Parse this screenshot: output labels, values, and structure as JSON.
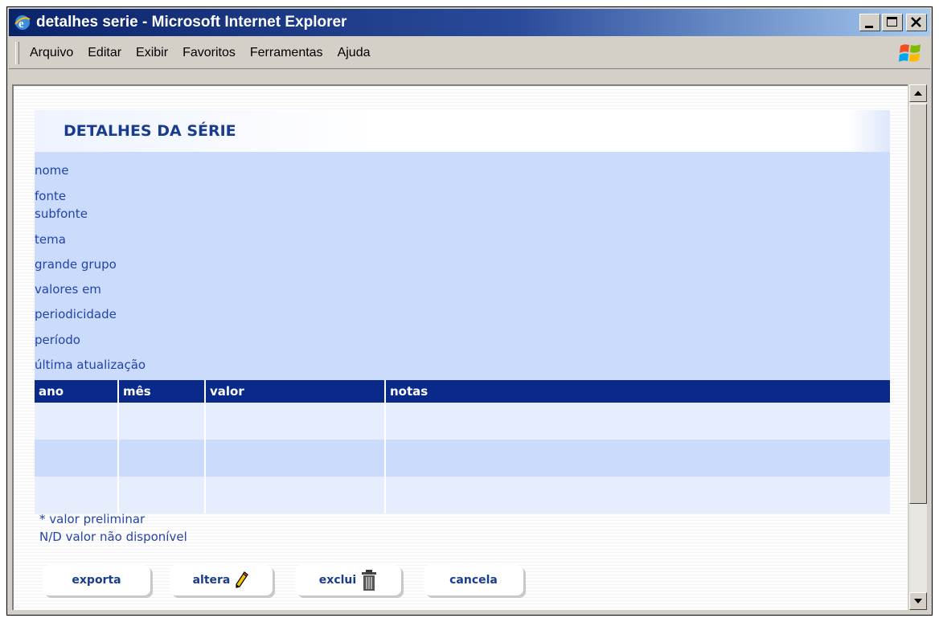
{
  "window": {
    "title": "detalhes serie - Microsoft Internet Explorer"
  },
  "menu": {
    "items": [
      {
        "label": "Arquivo"
      },
      {
        "label": "Editar"
      },
      {
        "label": "Exibir"
      },
      {
        "label": "Favoritos"
      },
      {
        "label": "Ferramentas"
      },
      {
        "label": "Ajuda"
      }
    ]
  },
  "page": {
    "title": "DETALHES DA SÉRIE",
    "fields": [
      {
        "label": "nome"
      },
      {
        "label": "fonte"
      },
      {
        "label": "subfonte"
      },
      {
        "label": "tema"
      },
      {
        "label": "grande grupo"
      },
      {
        "label": "valores em"
      },
      {
        "label": "periodicidade"
      },
      {
        "label": "período"
      },
      {
        "label": "última atualização"
      }
    ],
    "table": {
      "columns": [
        "ano",
        "mês",
        "valor",
        "notas"
      ]
    },
    "notes": {
      "preliminary": "* valor preliminar",
      "unavailable": "N/D valor não disponível"
    },
    "buttons": {
      "exporta": "exporta",
      "altera": "altera",
      "exclui": "exclui",
      "cancela": "cancela"
    }
  },
  "colors": {
    "title_gradient_start": "#0a246a",
    "panel_bg": "#cadbfc",
    "table_header_bg": "#0a2a8a",
    "label_text": "#2244aa"
  },
  "icons": [
    "ie-icon",
    "minimize-icon",
    "maximize-icon",
    "close-icon",
    "windows-logo-icon",
    "pencil-icon",
    "trash-icon",
    "scroll-up-icon",
    "scroll-down-icon"
  ]
}
